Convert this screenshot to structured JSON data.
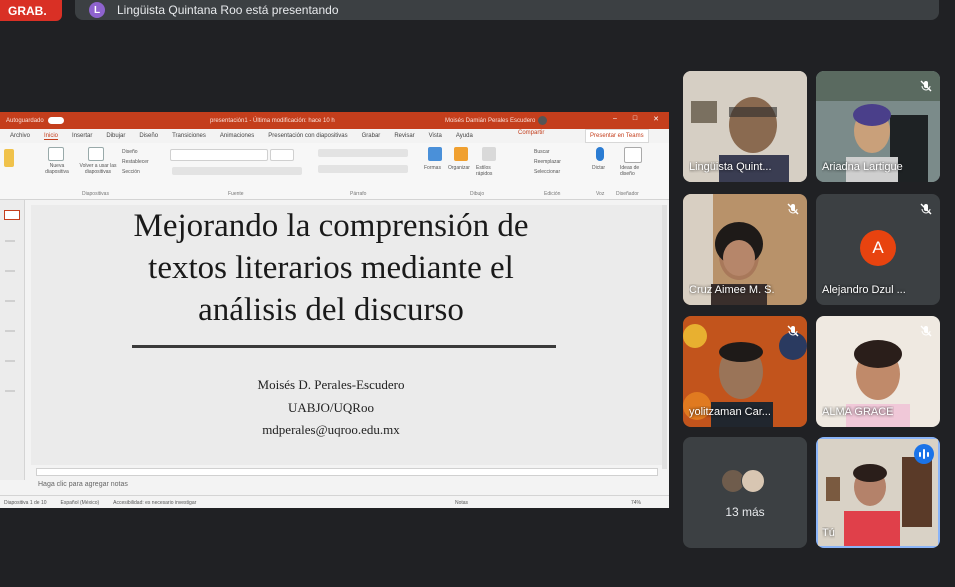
{
  "meet": {
    "live_badge": "GRAB.",
    "presenter_initial": "L",
    "presenting_text": "Lingüista Quintana Roo está presentando"
  },
  "ppt": {
    "autosave_label": "Autoguardado",
    "filename": "presentación1 - Última modificación: hace 10 h",
    "username": "Moisés Damián Perales Escudero",
    "tabs": [
      "Archivo",
      "Inicio",
      "Insertar",
      "Dibujar",
      "Diseño",
      "Transiciones",
      "Animaciones",
      "Presentación con diapositivas",
      "Grabar",
      "Revisar",
      "Vista",
      "Ayuda"
    ],
    "share_label": "Compartir",
    "present_teams_label": "Presentar en Teams",
    "ribbon": {
      "new_slide": "Nueva diapositiva",
      "reuse": "Volver a usar las diapositivas",
      "design": "Diseño",
      "restore": "Restablecer",
      "section": "Sección",
      "shapes": "Formas",
      "arrange": "Organizar",
      "quick_styles": "Estilos rápidos",
      "find": "Buscar",
      "replace": "Reemplazar",
      "select": "Seleccionar",
      "dictate": "Dictar",
      "design_ideas": "Ideas de diseño",
      "group_slides": "Diapositivas",
      "group_font": "Fuente",
      "group_paragraph": "Párrafo",
      "group_drawing": "Dibujo",
      "group_editing": "Edición",
      "group_voice": "Voz",
      "group_designer": "Diseñador"
    },
    "slide": {
      "title_line1": "Mejorando la comprensión de",
      "title_line2": "textos literarios mediante el",
      "title_line3": "análisis del discurso",
      "author": "Moisés D. Perales-Escudero",
      "affiliation": "UABJO/UQRoo",
      "email": "mdperales@uqroo.edu.mx"
    },
    "notes_placeholder": "Haga clic para agregar notas",
    "status": {
      "slide_count": "Diapositiva 1 de 10",
      "language": "Español (México)",
      "accessibility": "Accesibilidad: es necesario investigar",
      "notes": "Notas",
      "zoom": "74%"
    }
  },
  "participants": [
    {
      "name": "Lingüista Quint...",
      "muted": false
    },
    {
      "name": "Ariadna Lartigue",
      "muted": true
    },
    {
      "name": "Cruz Aimee M. S.",
      "muted": true
    },
    {
      "name": "Alejandro Dzul ...",
      "muted": true,
      "initial": "A"
    },
    {
      "name": "yolitzaman Car...",
      "muted": true
    },
    {
      "name": "ALMA GRACE",
      "muted": true
    },
    {
      "more_label": "13 más"
    },
    {
      "name": "Tú",
      "speaking": true
    }
  ],
  "colors": {
    "meet_bg": "#202124",
    "tile_bg": "#3c4043",
    "ppt_accent": "#c43e1c",
    "avatar_orange": "#e8430f",
    "active_blue": "#8ab4f8"
  }
}
